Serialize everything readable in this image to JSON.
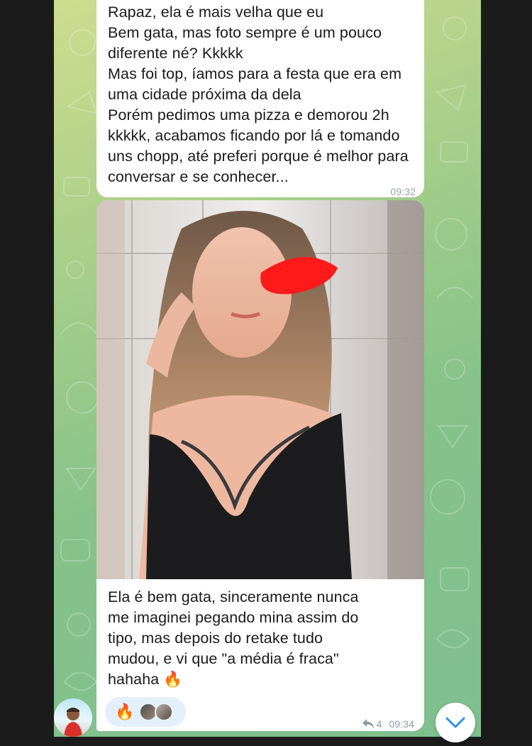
{
  "messages": {
    "text_message": {
      "lines": [
        "Rapaz, ela é mais velha que eu",
        "Bem gata, mas foto sempre é um pouco",
        "diferente né? Kkkkk",
        "Mas foi top, íamos para a festa que era em",
        "uma cidade próxima da dela",
        "Porém pedimos uma pizza e demorou 2h",
        "kkkkk, acabamos ficando por lá e tomando",
        "uns chopp, até preferi porque é melhor para",
        "conversar e se conhecer..."
      ],
      "time": "09:32"
    },
    "photo_message": {
      "caption_lines": [
        "Ela é bem gata, sinceramente nunca",
        "me imaginei pegando mina assim do",
        "tipo, mas depois do retake tudo",
        "mudou, e vi que \"a média é fraca\"",
        "hahaha 🔥"
      ],
      "reaction_emoji": "🔥",
      "reply_count": "4",
      "time": "09:34"
    }
  },
  "colors": {
    "bubble": "#ffffff",
    "reaction_pill": "#e3f0f9",
    "accent": "#3390ec",
    "redaction": "#ff1a1a"
  },
  "icons": [
    "reply-arrow-icon",
    "chevron-down-icon"
  ]
}
